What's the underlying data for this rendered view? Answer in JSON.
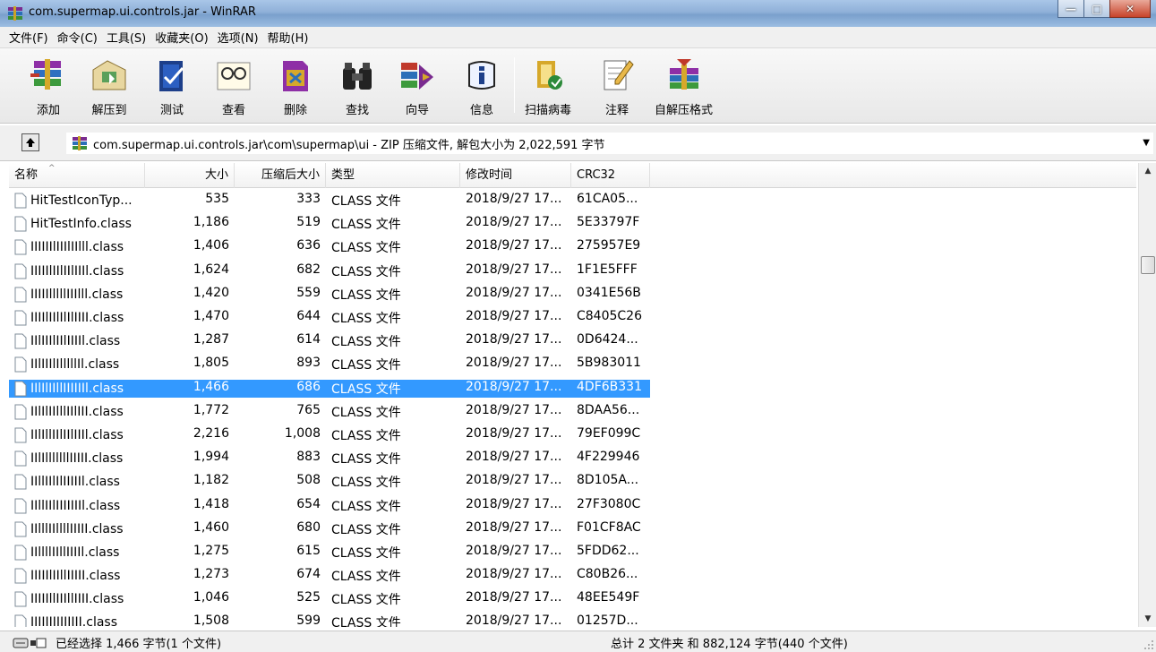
{
  "window": {
    "title": "com.supermap.ui.controls.jar - WinRAR",
    "min_glyph": "—",
    "max_glyph": "□",
    "close_glyph": "✕"
  },
  "menu": [
    "文件(F)",
    "命令(C)",
    "工具(S)",
    "收藏夹(O)",
    "选项(N)",
    "帮助(H)"
  ],
  "toolbar": [
    {
      "label": "添加",
      "icon": "add-archive-icon"
    },
    {
      "label": "解压到",
      "icon": "extract-to-icon"
    },
    {
      "label": "测试",
      "icon": "test-icon"
    },
    {
      "label": "查看",
      "icon": "view-icon"
    },
    {
      "label": "删除",
      "icon": "delete-icon"
    },
    {
      "label": "查找",
      "icon": "find-icon"
    },
    {
      "label": "向导",
      "icon": "wizard-icon"
    },
    {
      "label": "信息",
      "icon": "info-icon"
    },
    {
      "label": "扫描病毒",
      "icon": "virus-scan-icon"
    },
    {
      "label": "注释",
      "icon": "comment-icon"
    },
    {
      "label": "自解压格式",
      "icon": "sfx-icon"
    }
  ],
  "address": {
    "path": "com.supermap.ui.controls.jar\\com\\supermap\\ui - ZIP 压缩文件, 解包大小为 2,022,591 字节"
  },
  "columns": {
    "name": "名称",
    "size": "大小",
    "packed": "压缩后大小",
    "type": "类型",
    "modified": "修改时间",
    "crc": "CRC32"
  },
  "selected_index": 8,
  "files": [
    {
      "name": "HitTestIconTyp...",
      "size": "535",
      "packed": "333",
      "type": "CLASS 文件",
      "modified": "2018/9/27 17...",
      "crc": "61CA05..."
    },
    {
      "name": "HitTestInfo.class",
      "size": "1,186",
      "packed": "519",
      "type": "CLASS 文件",
      "modified": "2018/9/27 17...",
      "crc": "5E33797F"
    },
    {
      "name": "IIIIIIlIIIlIIlll.class",
      "size": "1,406",
      "packed": "636",
      "type": "CLASS 文件",
      "modified": "2018/9/27 17...",
      "crc": "275957E9"
    },
    {
      "name": "IIIIIlIIlIIlIIIl.class",
      "size": "1,624",
      "packed": "682",
      "type": "CLASS 文件",
      "modified": "2018/9/27 17...",
      "crc": "1F1E5FFF"
    },
    {
      "name": "IIIIIlllllIIIlll.class",
      "size": "1,420",
      "packed": "559",
      "type": "CLASS 文件",
      "modified": "2018/9/27 17...",
      "crc": "0341E56B"
    },
    {
      "name": "IIIIlIIlIlIlIIII.class",
      "size": "1,470",
      "packed": "644",
      "type": "CLASS 文件",
      "modified": "2018/9/27 17...",
      "crc": "C8405C26"
    },
    {
      "name": "IIlIIIlIIlIIIIl.class",
      "size": "1,287",
      "packed": "614",
      "type": "CLASS 文件",
      "modified": "2018/9/27 17...",
      "crc": "0D6424..."
    },
    {
      "name": "IIlIIIlIlllllIl.class",
      "size": "1,805",
      "packed": "893",
      "type": "CLASS 文件",
      "modified": "2018/9/27 17...",
      "crc": "5B983011"
    },
    {
      "name": "IIlIlIIllIIIIIIl.class",
      "size": "1,466",
      "packed": "686",
      "type": "CLASS 文件",
      "modified": "2018/9/27 17...",
      "crc": "4DF6B331"
    },
    {
      "name": "IIlIlIIlllIIlIII.class",
      "size": "1,772",
      "packed": "765",
      "type": "CLASS 文件",
      "modified": "2018/9/27 17...",
      "crc": "8DAA56..."
    },
    {
      "name": "IIlIllIIlIIlIIIl.class",
      "size": "2,216",
      "packed": "1,008",
      "type": "CLASS 文件",
      "modified": "2018/9/27 17...",
      "crc": "79EF099C"
    },
    {
      "name": "IIlIlllllllIIIII.class",
      "size": "1,994",
      "packed": "883",
      "type": "CLASS 文件",
      "modified": "2018/9/27 17...",
      "crc": "4F229946"
    },
    {
      "name": "IIllIIlIlIIIIIl.class",
      "size": "1,182",
      "packed": "508",
      "type": "CLASS 文件",
      "modified": "2018/9/27 17...",
      "crc": "8D105A..."
    },
    {
      "name": "IIllIIlIIIIIIIl.class",
      "size": "1,418",
      "packed": "654",
      "type": "CLASS 文件",
      "modified": "2018/9/27 17...",
      "crc": "27F3080C"
    },
    {
      "name": "IIlllIIllllIIIII.class",
      "size": "1,460",
      "packed": "680",
      "type": "CLASS 文件",
      "modified": "2018/9/27 17...",
      "crc": "F01CF8AC"
    },
    {
      "name": "IIllllIIllIIIIl.class",
      "size": "1,275",
      "packed": "615",
      "type": "CLASS 文件",
      "modified": "2018/9/27 17...",
      "crc": "5FDD62..."
    },
    {
      "name": "IIIIIlIIllIIIII.class",
      "size": "1,273",
      "packed": "674",
      "type": "CLASS 文件",
      "modified": "2018/9/27 17...",
      "crc": "C80B26..."
    },
    {
      "name": "IIIIIllIIIllIIII.class",
      "size": "1,046",
      "packed": "525",
      "type": "CLASS 文件",
      "modified": "2018/9/27 17...",
      "crc": "48EE549F"
    },
    {
      "name": "IIIIIIIIIIIIII.class",
      "size": "1,508",
      "packed": "599",
      "type": "CLASS 文件",
      "modified": "2018/9/27 17...",
      "crc": "01257D..."
    }
  ],
  "status": {
    "left": "已经选择 1,466 字节(1 个文件)",
    "right": "总计 2 文件夹 和 882,124 字节(440 个文件)"
  },
  "scrollbar": {
    "up_glyph": "▲",
    "down_glyph": "▼"
  }
}
